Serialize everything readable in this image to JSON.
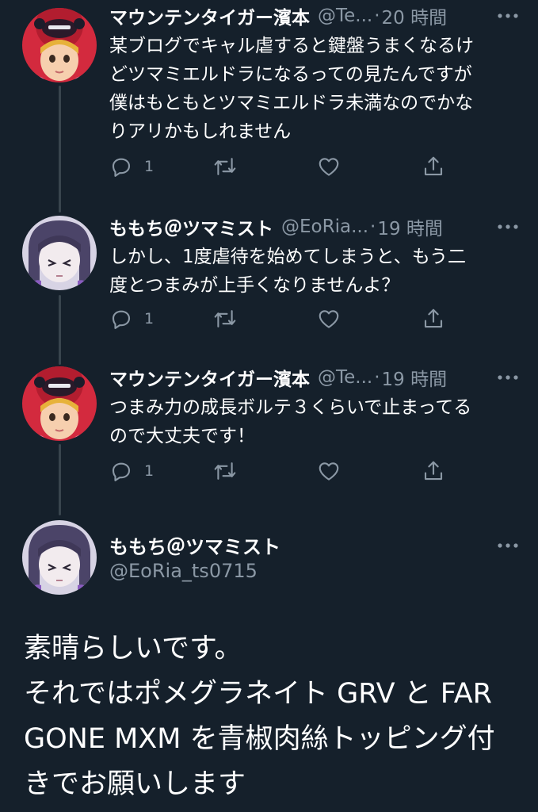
{
  "tweets": [
    {
      "name": "マウンテンタイガー濱本",
      "handle": "@Te...",
      "time": "20 時間",
      "text": "某ブログでキャル虐すると鍵盤うまくなるけ\nどツマミエルドラになるっての見たんですが\n僕はもともとツマミエルドラ未満なのでかな\nりアリかもしれません",
      "reply_count": "1",
      "avatar": "red-mask-avatar"
    },
    {
      "name": "ももち＠ツマミスト",
      "handle": "@EoRia...",
      "time": "19 時間",
      "text": "しかし、1度虐待を始めてしまうと、もう二\n度とつまみが上手くなりませんよ？",
      "reply_count": "1",
      "avatar": "purple-hair-avatar"
    },
    {
      "name": "マウンテンタイガー濱本",
      "handle": "@Te...",
      "time": "19 時間",
      "text": "つまみ力の成長ボルテ３くらいで止まってる\nので大丈夫です！",
      "reply_count": "1",
      "avatar": "red-mask-avatar"
    }
  ],
  "main_tweet": {
    "name": "ももち＠ツマミスト",
    "handle": "@EoRia_ts0715",
    "text": "素晴らしいです。\nそれではポメグラネイト GRV と FAR\nGONE MXM を青椒肉絲トッピング付\nきでお願いします",
    "avatar": "purple-hair-avatar"
  },
  "colors": {
    "background": "#15202b",
    "secondary_text": "#8b98a5",
    "thread_line": "#38444d"
  },
  "icons": [
    "reply-icon",
    "retweet-icon",
    "like-icon",
    "share-icon",
    "more-icon"
  ]
}
